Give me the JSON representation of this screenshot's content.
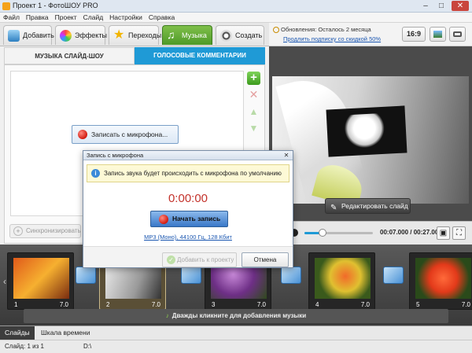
{
  "window": {
    "title": "Проект 1 - ФотоШОУ PRO",
    "min": "–",
    "max": "□",
    "close": "✕"
  },
  "menu": [
    "Файл",
    "Правка",
    "Проект",
    "Слайд",
    "Настройки",
    "Справка"
  ],
  "tabs": [
    {
      "label": "Добавить",
      "icon": "folder-icon"
    },
    {
      "label": "Эффекты",
      "icon": "effects-icon"
    },
    {
      "label": "Переходы",
      "icon": "star-icon"
    },
    {
      "label": "Музыка",
      "icon": "music-icon",
      "active": true
    },
    {
      "label": "Создать",
      "icon": "film-reel-icon"
    }
  ],
  "updates": {
    "status": "Обновления: Осталось 2 месяца",
    "link": "Продлить подписку со скидкой 50%"
  },
  "aspect": "16:9",
  "subtabs": {
    "music": "МУЗЫКА СЛАЙД-ШОУ",
    "voice": "ГОЛОСОВЫЕ КОММЕНТАРИИ"
  },
  "record_mic_button": "Записать с микрофона...",
  "sync_button": "Синхронизировать",
  "edit_slide_button": "Редактировать слайд",
  "player": {
    "time": "00:07.000 / 00:27.000",
    "position": 0.26
  },
  "slides": [
    {
      "num": "1",
      "duration": "7.0"
    },
    {
      "num": "2",
      "duration": "7.0"
    },
    {
      "num": "3",
      "duration": "7.0"
    },
    {
      "num": "4",
      "duration": "7.0"
    },
    {
      "num": "5",
      "duration": "7.0"
    }
  ],
  "music_hint": "Дважды кликните для добавления музыки",
  "bottom_tabs": [
    "Слайды",
    "Шкала времени"
  ],
  "status": {
    "slide": "Слайд: 1 из 1",
    "path": "D:\\"
  },
  "dialog": {
    "title": "Запись с микрофона",
    "info": "Запись звука будет происходить с микрофона по умолчанию",
    "timer": "0:00:00",
    "start": "Начать запись",
    "format": "MP3 (Моно), 44100 Гц, 128 Кбит",
    "add": "Добавить к проекту",
    "cancel": "Отмена"
  },
  "colors": {
    "accent_green": "#5aa631",
    "accent_blue": "#1f9ad6",
    "record_red": "#d21b10"
  }
}
